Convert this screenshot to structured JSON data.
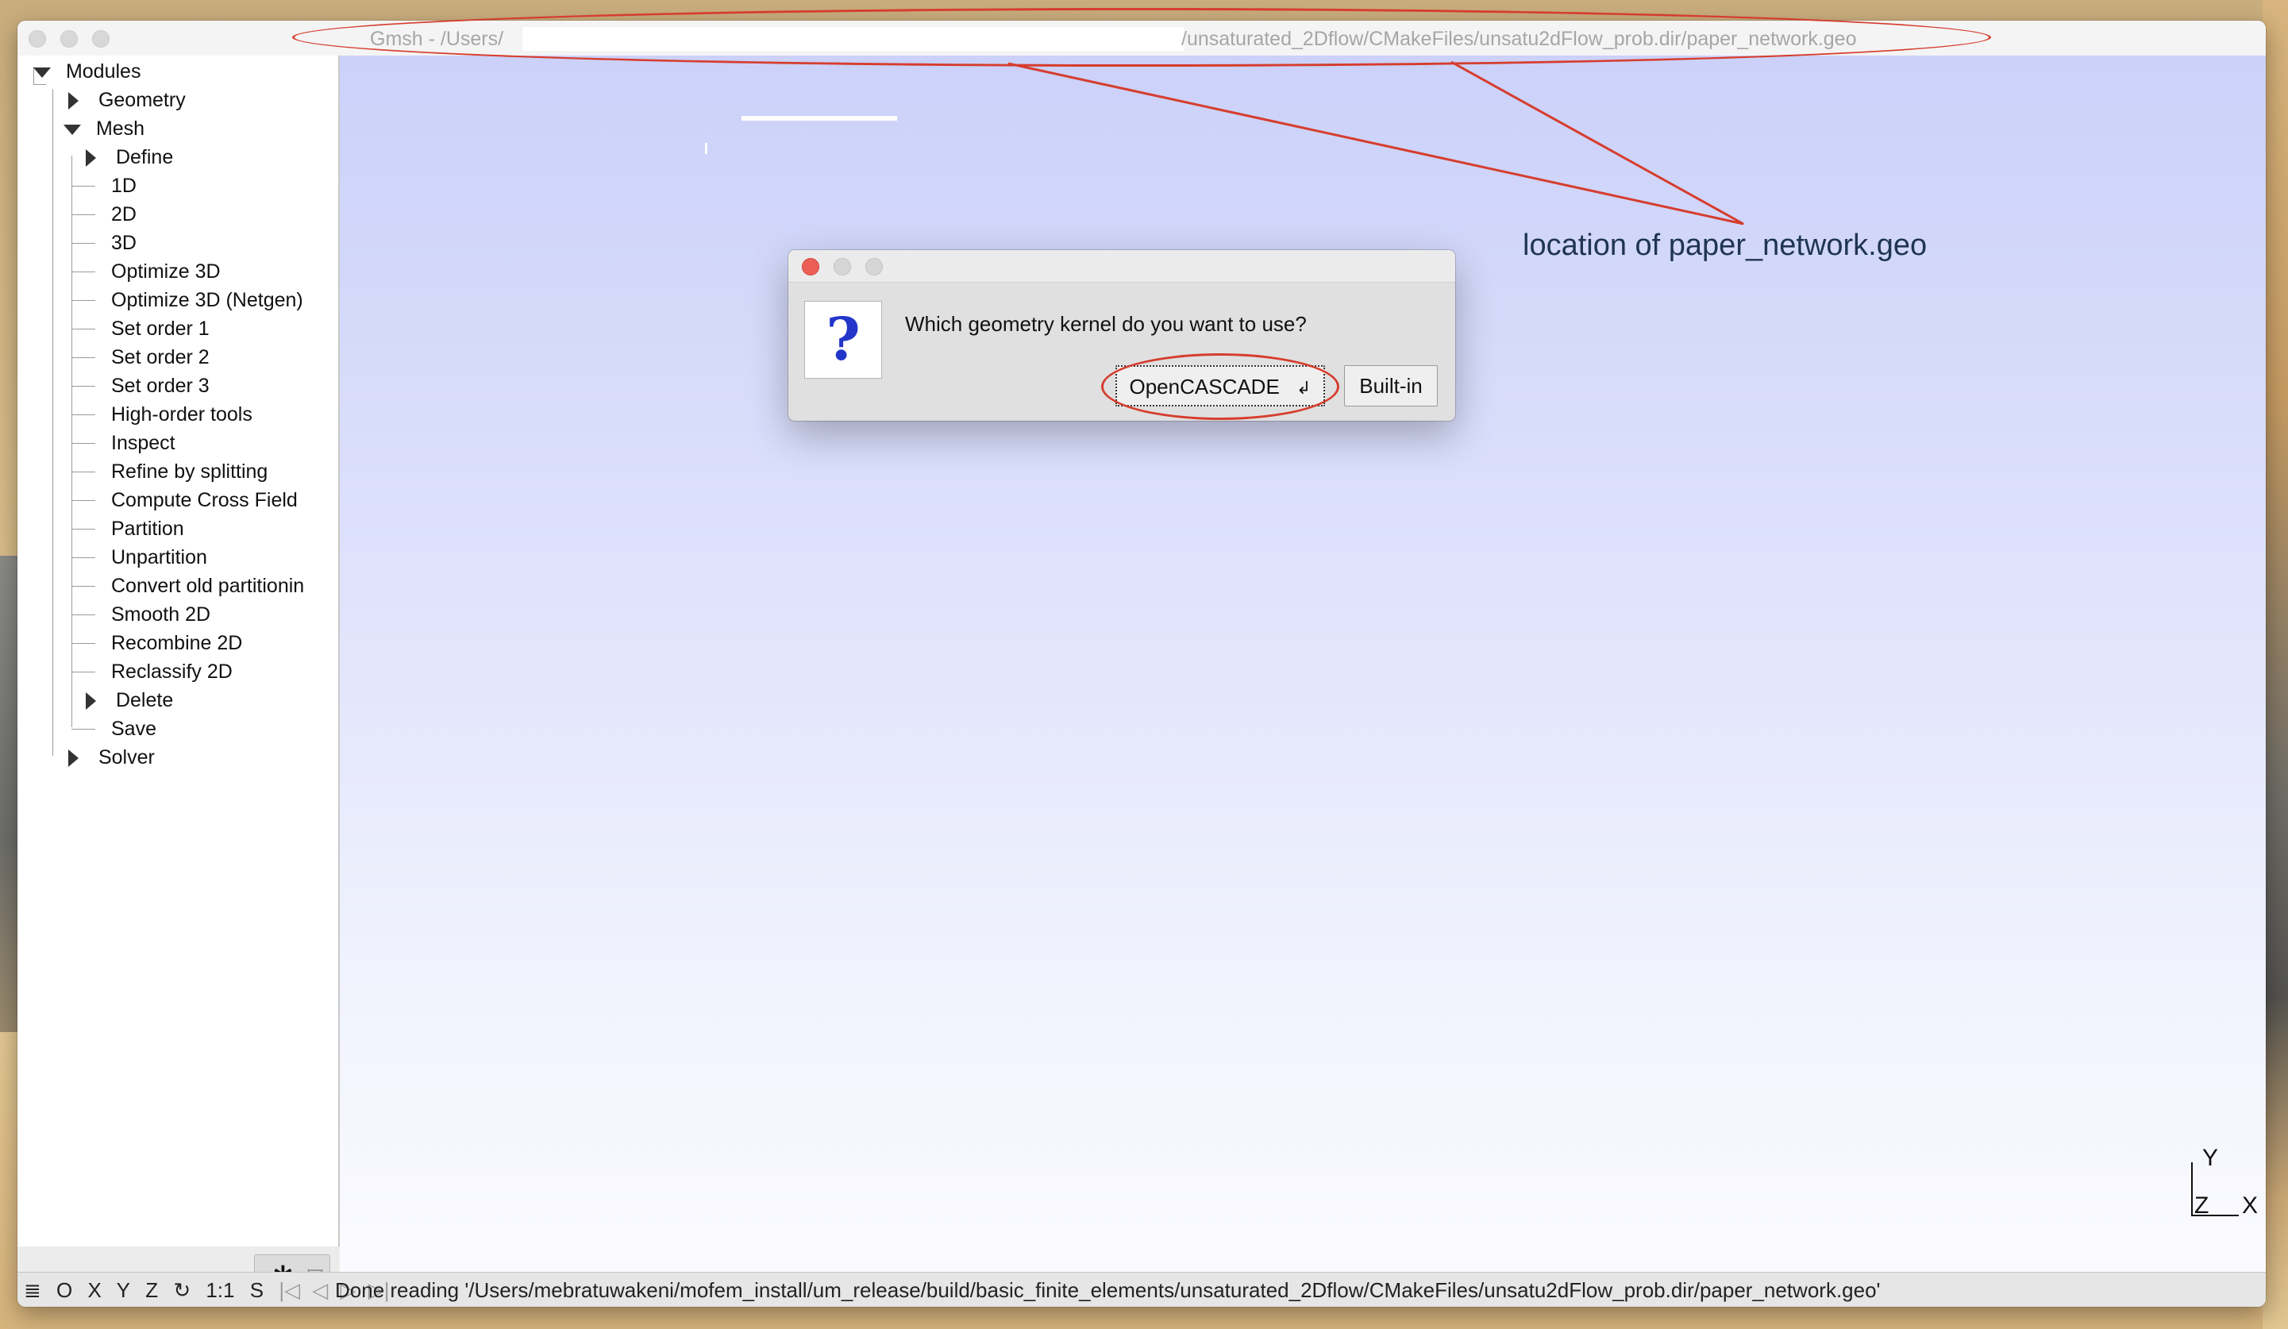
{
  "window": {
    "title_prefix": "Gmsh - /Users/",
    "title_suffix": "/unsaturated_2Dflow/CMakeFiles/unsatu2dFlow_prob.dir/paper_network.geo"
  },
  "tree": {
    "root": "Modules",
    "geometry": "Geometry",
    "mesh": "Mesh",
    "mesh_items": [
      "Define",
      "1D",
      "2D",
      "3D",
      "Optimize 3D",
      "Optimize 3D (Netgen)",
      "Set order 1",
      "Set order 2",
      "Set order 3",
      "High-order tools",
      "Inspect",
      "Refine by splitting",
      "Compute Cross Field",
      "Partition",
      "Unpartition",
      "Convert old partitionin",
      "Smooth 2D",
      "Recombine 2D",
      "Reclassify 2D",
      "Delete",
      "Save"
    ],
    "solver": "Solver"
  },
  "dialog": {
    "icon_glyph": "?",
    "message": "Which geometry kernel do you want to use?",
    "button_opencascade": "OpenCASCADE",
    "button_builtin": "Built-in"
  },
  "annotation": {
    "text": "location of paper_network.geo",
    "color": "#d63d2e"
  },
  "axes": {
    "y": "Y",
    "z": "Z",
    "x": "X"
  },
  "statusbar": {
    "menu_glyph": "≣",
    "o": "O",
    "x": "X",
    "y": "Y",
    "z": "Z",
    "rotate_glyph": "↻",
    "scale": "1:1",
    "s": "S",
    "nav_first": "|◁",
    "nav_prev": "◁",
    "nav_next": "▷",
    "nav_last": "▷|",
    "message": "Done reading '/Users/mebratuwakeni/mofem_install/um_release/build/basic_finite_elements/unsaturated_2Dflow/CMakeFiles/unsatu2dFlow_prob.dir/paper_network.geo'"
  },
  "colors": {
    "accent_red": "#d63d2e",
    "viewport_top": "#cbd1f9",
    "viewport_bottom": "#fbfbff"
  }
}
